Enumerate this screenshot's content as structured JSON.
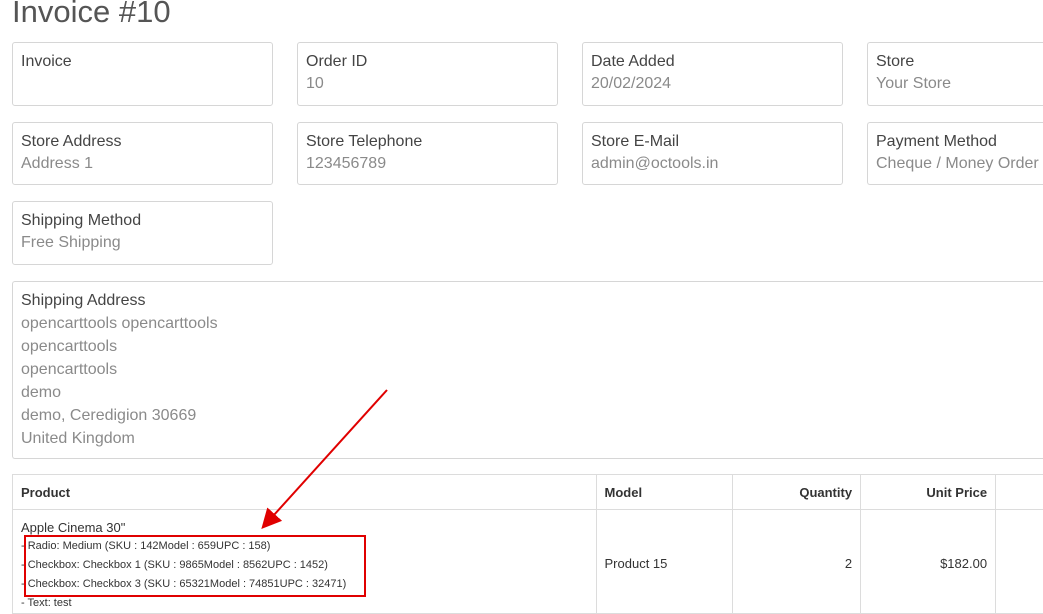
{
  "page": {
    "title": "Invoice #10"
  },
  "cards": {
    "invoice": {
      "label": "Invoice",
      "value": ""
    },
    "order_id": {
      "label": "Order ID",
      "value": "10"
    },
    "date_added": {
      "label": "Date Added",
      "value": "20/02/2024"
    },
    "store": {
      "label": "Store",
      "value": "Your Store"
    },
    "store_address": {
      "label": "Store Address",
      "value": "Address 1"
    },
    "store_telephone": {
      "label": "Store Telephone",
      "value": "123456789"
    },
    "store_email": {
      "label": "Store E-Mail",
      "value": "admin@octools.in"
    },
    "payment_method": {
      "label": "Payment Method",
      "value": "Cheque / Money Order"
    },
    "shipping_method": {
      "label": "Shipping Method",
      "value": "Free Shipping"
    }
  },
  "shipping_address": {
    "label": "Shipping Address",
    "lines": [
      "opencarttools opencarttools",
      "opencarttools",
      "opencarttools",
      "demo",
      "demo, Ceredigion 30669",
      "United Kingdom"
    ]
  },
  "table": {
    "headers": [
      "Product",
      "Model",
      "Quantity",
      "Unit Price"
    ],
    "rows": [
      {
        "product": "Apple Cinema 30\"",
        "options": [
          "- Radio: Medium (SKU : 142Model : 659UPC : 158)",
          "- Checkbox: Checkbox 1 (SKU : 9865Model : 8562UPC : 1452)",
          "- Checkbox: Checkbox 3 (SKU : 65321Model : 74851UPC : 32471)",
          "- Text: test"
        ],
        "model": "Product 15",
        "quantity": "2",
        "unit_price": "$182.00"
      }
    ]
  },
  "annotation": {
    "color": "#e00000"
  }
}
